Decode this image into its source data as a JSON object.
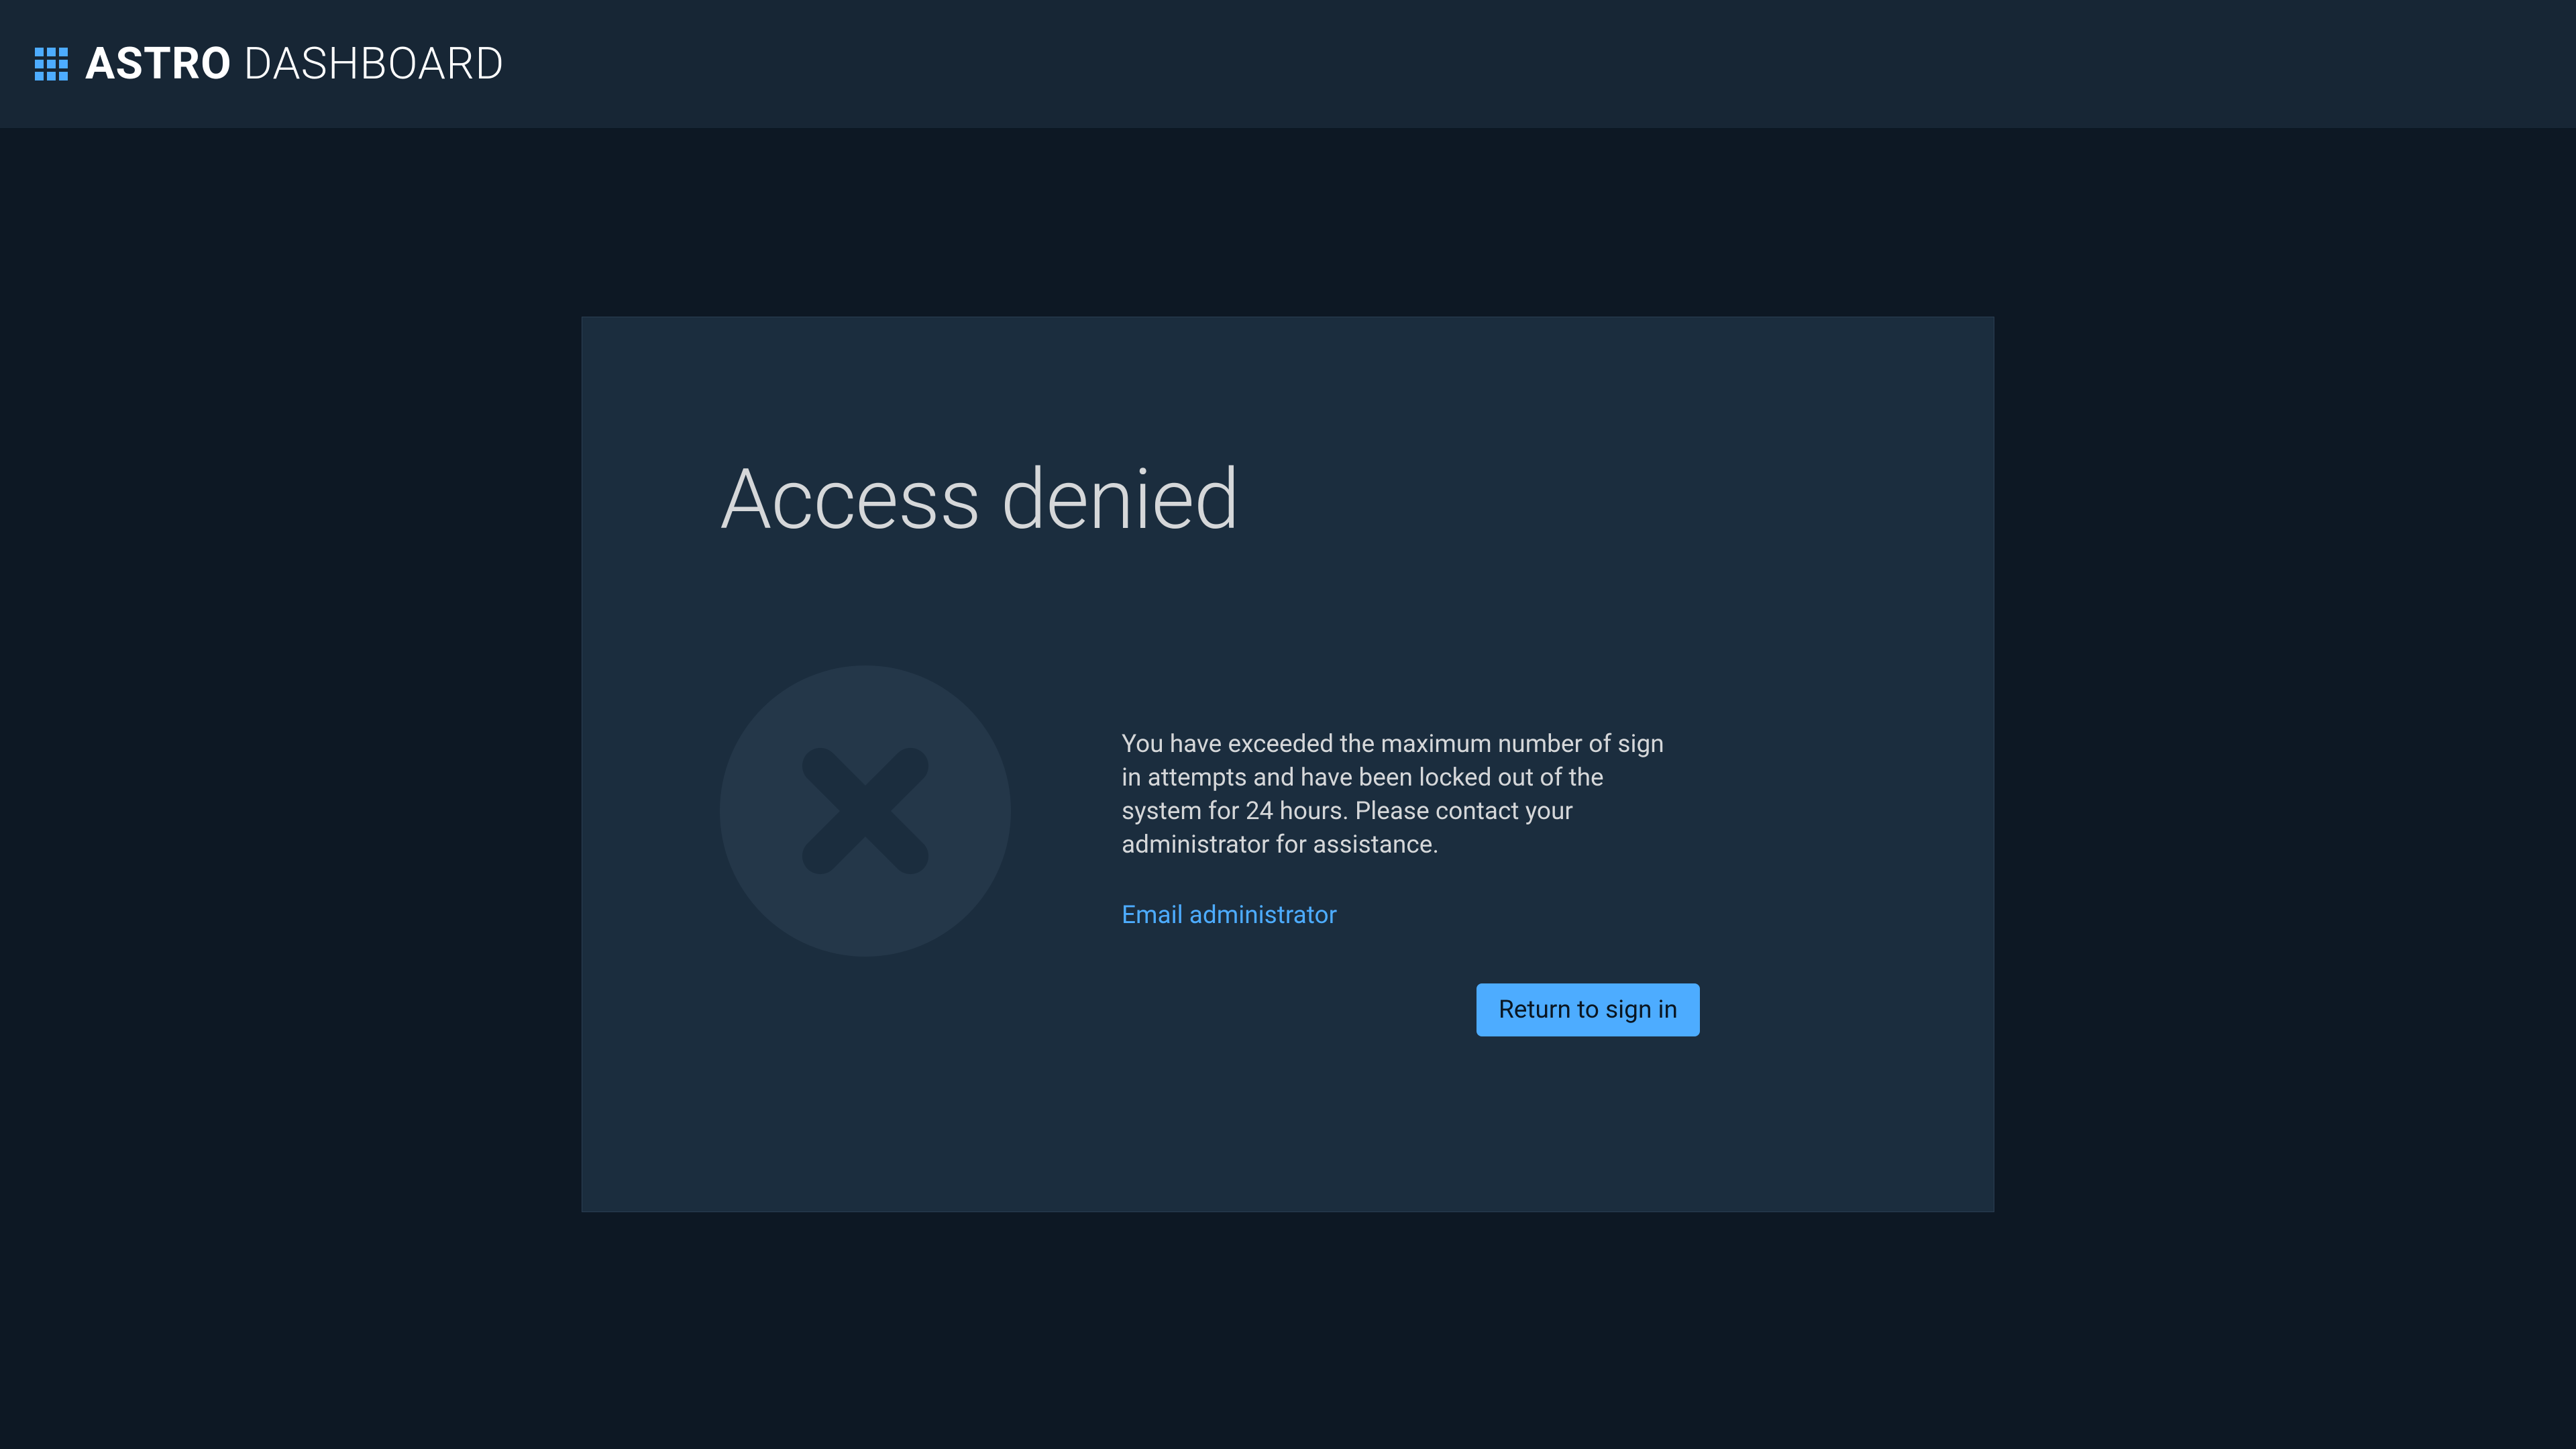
{
  "header": {
    "title_bold": "ASTRO",
    "title_light": " DASHBOARD"
  },
  "card": {
    "title": "Access denied",
    "message": "You have exceeded the maximum number of sign in attempts and have been locked out of the system for 24 hours. Please contact your administrator for assistance.",
    "email_link_text": "Email administrator",
    "button_label": "Return to sign in"
  }
}
